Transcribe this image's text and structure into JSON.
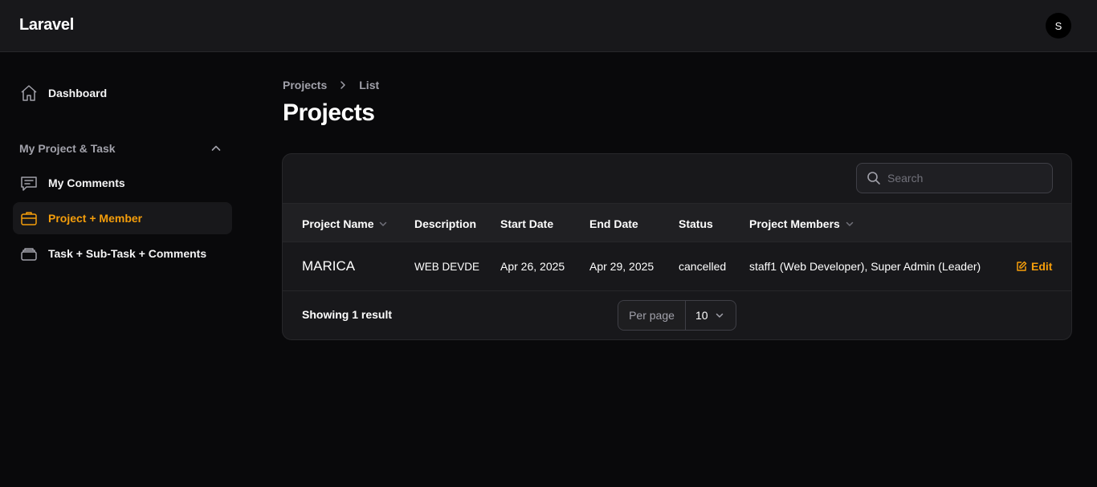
{
  "app": {
    "brand": "Laravel",
    "user_initial": "S"
  },
  "sidebar": {
    "items": [
      {
        "label": "Dashboard",
        "icon": "home-icon"
      }
    ],
    "group": {
      "label": "My Project & Task",
      "items": [
        {
          "label": "My Comments",
          "icon": "comment-icon"
        },
        {
          "label": "Project + Member",
          "icon": "briefcase-icon",
          "active": true
        },
        {
          "label": "Task + Sub-Task + Comments",
          "icon": "stack-icon"
        }
      ]
    }
  },
  "breadcrumb": [
    "Projects",
    "List"
  ],
  "page": {
    "title": "Projects"
  },
  "table": {
    "search_placeholder": "Search",
    "columns": [
      "Project Name",
      "Description",
      "Start Date",
      "End Date",
      "Status",
      "Project Members"
    ],
    "rows": [
      {
        "name": "MARICA",
        "description": "WEB DEVDE",
        "start_date": "Apr 26, 2025",
        "end_date": "Apr 29, 2025",
        "status": "cancelled",
        "members": "staff1 (Web Developer), Super Admin (Leader)",
        "action": "Edit"
      }
    ],
    "footer": {
      "showing": "Showing 1 result",
      "per_page_label": "Per page",
      "per_page_value": "10"
    }
  },
  "colors": {
    "accent": "#f59e0b",
    "background": "#09090b",
    "surface": "#18181b"
  }
}
